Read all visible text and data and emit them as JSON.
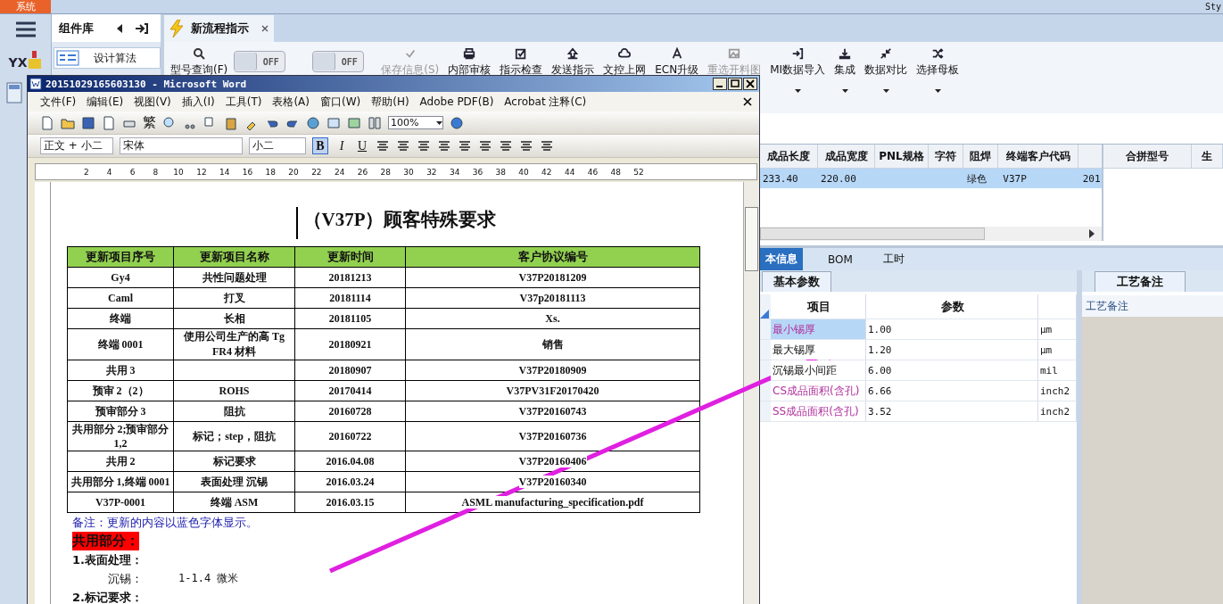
{
  "app": {
    "menu_tab": "系统",
    "corner_text": "Sty",
    "logo_text": "YX",
    "side_panel": {
      "title": "组件库",
      "items": [
        {
          "label": "设计算法"
        }
      ]
    },
    "doc_tabs": [
      {
        "label": "新流程指示",
        "selected": true,
        "closable": true
      }
    ],
    "search_button": "型号查询(F)",
    "toggles": [
      {
        "label": "OFF",
        "on": false
      },
      {
        "label": "OFF",
        "on": false
      }
    ],
    "toolbar": [
      {
        "label": "保存信息(S)",
        "kind": "check",
        "disabled": true,
        "dropdown": false
      },
      {
        "label": "内部审核",
        "kind": "print",
        "disabled": false,
        "dropdown": false
      },
      {
        "label": "指示检查",
        "kind": "checkbox",
        "disabled": false,
        "dropdown": false
      },
      {
        "label": "发送指示",
        "kind": "upload",
        "disabled": false,
        "dropdown": false
      },
      {
        "label": "文控上网",
        "kind": "cloud",
        "disabled": false,
        "dropdown": false
      },
      {
        "label": "ECN升级",
        "kind": "font",
        "disabled": false,
        "dropdown": false
      },
      {
        "label": "重选开料图",
        "kind": "image",
        "disabled": true,
        "dropdown": false
      },
      {
        "label": "MI数据导入",
        "kind": "import",
        "disabled": false,
        "dropdown": true
      },
      {
        "label": "集成",
        "kind": "download",
        "disabled": false,
        "dropdown": true
      },
      {
        "label": "数据对比",
        "kind": "compress",
        "disabled": false,
        "dropdown": true
      },
      {
        "label": "选择母板",
        "kind": "shuffle",
        "disabled": false,
        "dropdown": true
      }
    ],
    "grid": {
      "columns": [
        "成品长度",
        "成品宽度",
        "PNL规格",
        "字符",
        "阻焊",
        "终端客户代码"
      ],
      "rows": [
        {
          "cells": [
            "233.40",
            "220.00",
            "",
            "",
            "绿色",
            "V37P",
            "201"
          ],
          "selected": true
        }
      ]
    },
    "merge_grid": {
      "columns": [
        "合拼型号",
        "生"
      ]
    },
    "detail_tabs": [
      {
        "label": "本信息",
        "selected": true
      },
      {
        "label": "BOM",
        "selected": false
      },
      {
        "label": "工时",
        "selected": false
      }
    ],
    "param_tab": "基本参数",
    "params": {
      "columns": [
        "项目",
        "参数"
      ],
      "rows": [
        {
          "item": "最小锡厚",
          "value": "1.00",
          "unit": "μm",
          "highlighted": true,
          "selected": true
        },
        {
          "item": "最大锡厚",
          "value": "1.20",
          "unit": "μm",
          "highlighted": false,
          "selected": false
        },
        {
          "item": "沉锡最小间距",
          "value": "6.00",
          "unit": "mil",
          "highlighted": false,
          "selected": false
        },
        {
          "item": "CS成品面积(含孔)",
          "value": "6.66",
          "unit": "inch2",
          "highlighted": true,
          "selected": false
        },
        {
          "item": "SS成品面积(含孔)",
          "value": "3.52",
          "unit": "inch2",
          "highlighted": true,
          "selected": false
        }
      ]
    },
    "notes_tab": "工艺备注",
    "notes_header": "工艺备注"
  },
  "word": {
    "title": "20151029165603130 - Microsoft Word",
    "menu": [
      "文件(F)",
      "编辑(E)",
      "视图(V)",
      "插入(I)",
      "工具(T)",
      "表格(A)",
      "窗口(W)",
      "帮助(H)",
      "Adobe PDF(B)",
      "Acrobat 注释(C)"
    ],
    "trad_button": "繁",
    "zoom": "100%",
    "style": "正文 + 小二",
    "font": "宋体",
    "size": "小二",
    "format_buttons": [
      {
        "label": "B",
        "pressed": true
      },
      {
        "label": "I",
        "pressed": false
      },
      {
        "label": "U",
        "pressed": false
      }
    ],
    "ruler": [
      "2",
      "4",
      "6",
      "8",
      "10",
      "12",
      "14",
      "16",
      "18",
      "20",
      "22",
      "24",
      "26",
      "28",
      "30",
      "32",
      "34",
      "36",
      "38",
      "40",
      "42",
      "44",
      "46",
      "48",
      "52"
    ],
    "document": {
      "title": "（V37P）顾客特殊要求",
      "columns": [
        "更新项目序号",
        "更新项目名称",
        "更新时间",
        "客户协议编号"
      ],
      "rows": [
        {
          "cells": [
            "Gy4",
            "共性问题处理",
            "20181213",
            "V37P20181209"
          ]
        },
        {
          "cells": [
            "Caml",
            "打叉",
            "20181114",
            "V37p20181113"
          ]
        },
        {
          "cells": [
            "终端",
            "长相",
            "20181105",
            "Xs."
          ]
        },
        {
          "cells": [
            "终端 0001",
            "使用公司生产的高 Tg FR4 材料",
            "20180921",
            "销售"
          ]
        },
        {
          "cells": [
            "共用 3",
            "",
            "20180907",
            "V37P20180909"
          ]
        },
        {
          "cells": [
            "预审 2（2）",
            "ROHS",
            "20170414",
            "V37PV31F20170420"
          ]
        },
        {
          "cells": [
            "预审部分 3",
            "阻抗",
            "20160728",
            "V37P20160743"
          ]
        },
        {
          "cells": [
            "共用部分 2;预审部分 1,2",
            "标记；step，阻抗",
            "20160722",
            "V37P20160736"
          ]
        },
        {
          "cells": [
            "共用 2",
            "标记要求",
            "2016.04.08",
            "V37P20160406"
          ]
        },
        {
          "cells": [
            "共用部分 1,终端 0001",
            "表面处理 沉锡",
            "2016.03.24",
            "V37P20160340"
          ]
        },
        {
          "cells": [
            "V37P-0001",
            "终端 ASM",
            "2016.03.15",
            "ASML manufacturing_specification.pdf"
          ]
        }
      ],
      "paragraphs": [
        {
          "kind": "note",
          "text": "备注：更新的内容以蓝色字体显示。"
        },
        {
          "kind": "highlight",
          "text": "共用部分："
        },
        {
          "kind": "heading",
          "text": "1.表面处理："
        },
        {
          "kind": "pair",
          "text": "沉锡：",
          "value": "1-1.4 微米"
        },
        {
          "kind": "heading",
          "text": "2.标记要求："
        }
      ]
    }
  }
}
